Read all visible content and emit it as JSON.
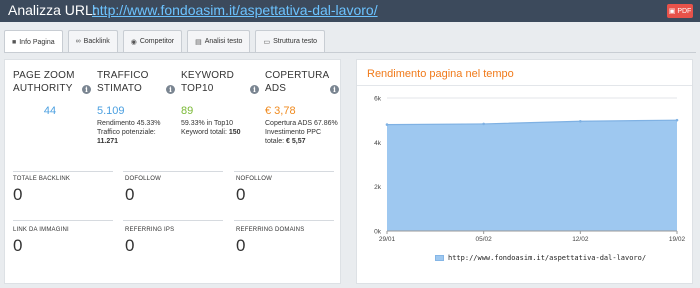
{
  "header": {
    "title": "Analizza URL:",
    "url": "http://www.fondoasim.it/aspettativa-dal-lavoro/",
    "pdf_label": "PDF"
  },
  "tabs": [
    {
      "label": "Info Pagina",
      "icon": "document-icon",
      "active": true
    },
    {
      "label": "Backlink",
      "icon": "link-icon",
      "active": false
    },
    {
      "label": "Competitor",
      "icon": "eye-icon",
      "active": false
    },
    {
      "label": "Analisi testo",
      "icon": "text-doc-icon",
      "active": false
    },
    {
      "label": "Struttura testo",
      "icon": "structure-icon",
      "active": false
    }
  ],
  "metrics": {
    "page_zoom": {
      "label_l1": "PAGE ZOOM",
      "label_l2": "AUTHORITY",
      "value": "44",
      "color": "#4a9fe0"
    },
    "traffico": {
      "label_l1": "TRAFFICO",
      "label_l2": "STIMATO",
      "value": "5.109",
      "color": "#4a9fe0",
      "sub1": "Rendimento 45.33%",
      "sub2_label": "Traffico potenziale:",
      "sub2_value": "11.271"
    },
    "keyword": {
      "label_l1": "KEYWORD",
      "label_l2": "TOP10",
      "value": "89",
      "color": "#7ab935",
      "sub1": "59.33% in Top10",
      "sub2_label": "Keyword totali:",
      "sub2_value": "150"
    },
    "copertura": {
      "label_l1": "COPERTURA",
      "label_l2": "ADS",
      "value": "€ 3,78",
      "color": "#f08a1e",
      "sub1": "Copertura ADS 67.86%",
      "sub2_label": "Investimento PPC",
      "sub3_label": "totale:",
      "sub3_value": "€ 5,57"
    }
  },
  "counters": [
    {
      "label": "TOTALE BACKLINK",
      "value": "0"
    },
    {
      "label": "DOFOLLOW",
      "value": "0"
    },
    {
      "label": "NOFOLLOW",
      "value": "0"
    },
    {
      "label": "LINK DA IMMAGINI",
      "value": "0"
    },
    {
      "label": "REFERRING IPS",
      "value": "0"
    },
    {
      "label": "REFERRING DOMAINS",
      "value": "0"
    }
  ],
  "chart_data": {
    "type": "area",
    "title": "Rendimento pagina nel tempo",
    "x": [
      "29/01",
      "05/02",
      "12/02",
      "19/02"
    ],
    "y_ticks": [
      "0k",
      "2k",
      "4k",
      "6k"
    ],
    "ylim": [
      0,
      6000
    ],
    "series": [
      {
        "name": "http://www.fondoasim.it/aspettativa-dal-lavoro/",
        "x": [
          0,
          7,
          14,
          21
        ],
        "values": [
          4800,
          4830,
          4950,
          5000
        ],
        "color": "#9ec8f0"
      }
    ],
    "grid": true,
    "legend": "bottom"
  }
}
